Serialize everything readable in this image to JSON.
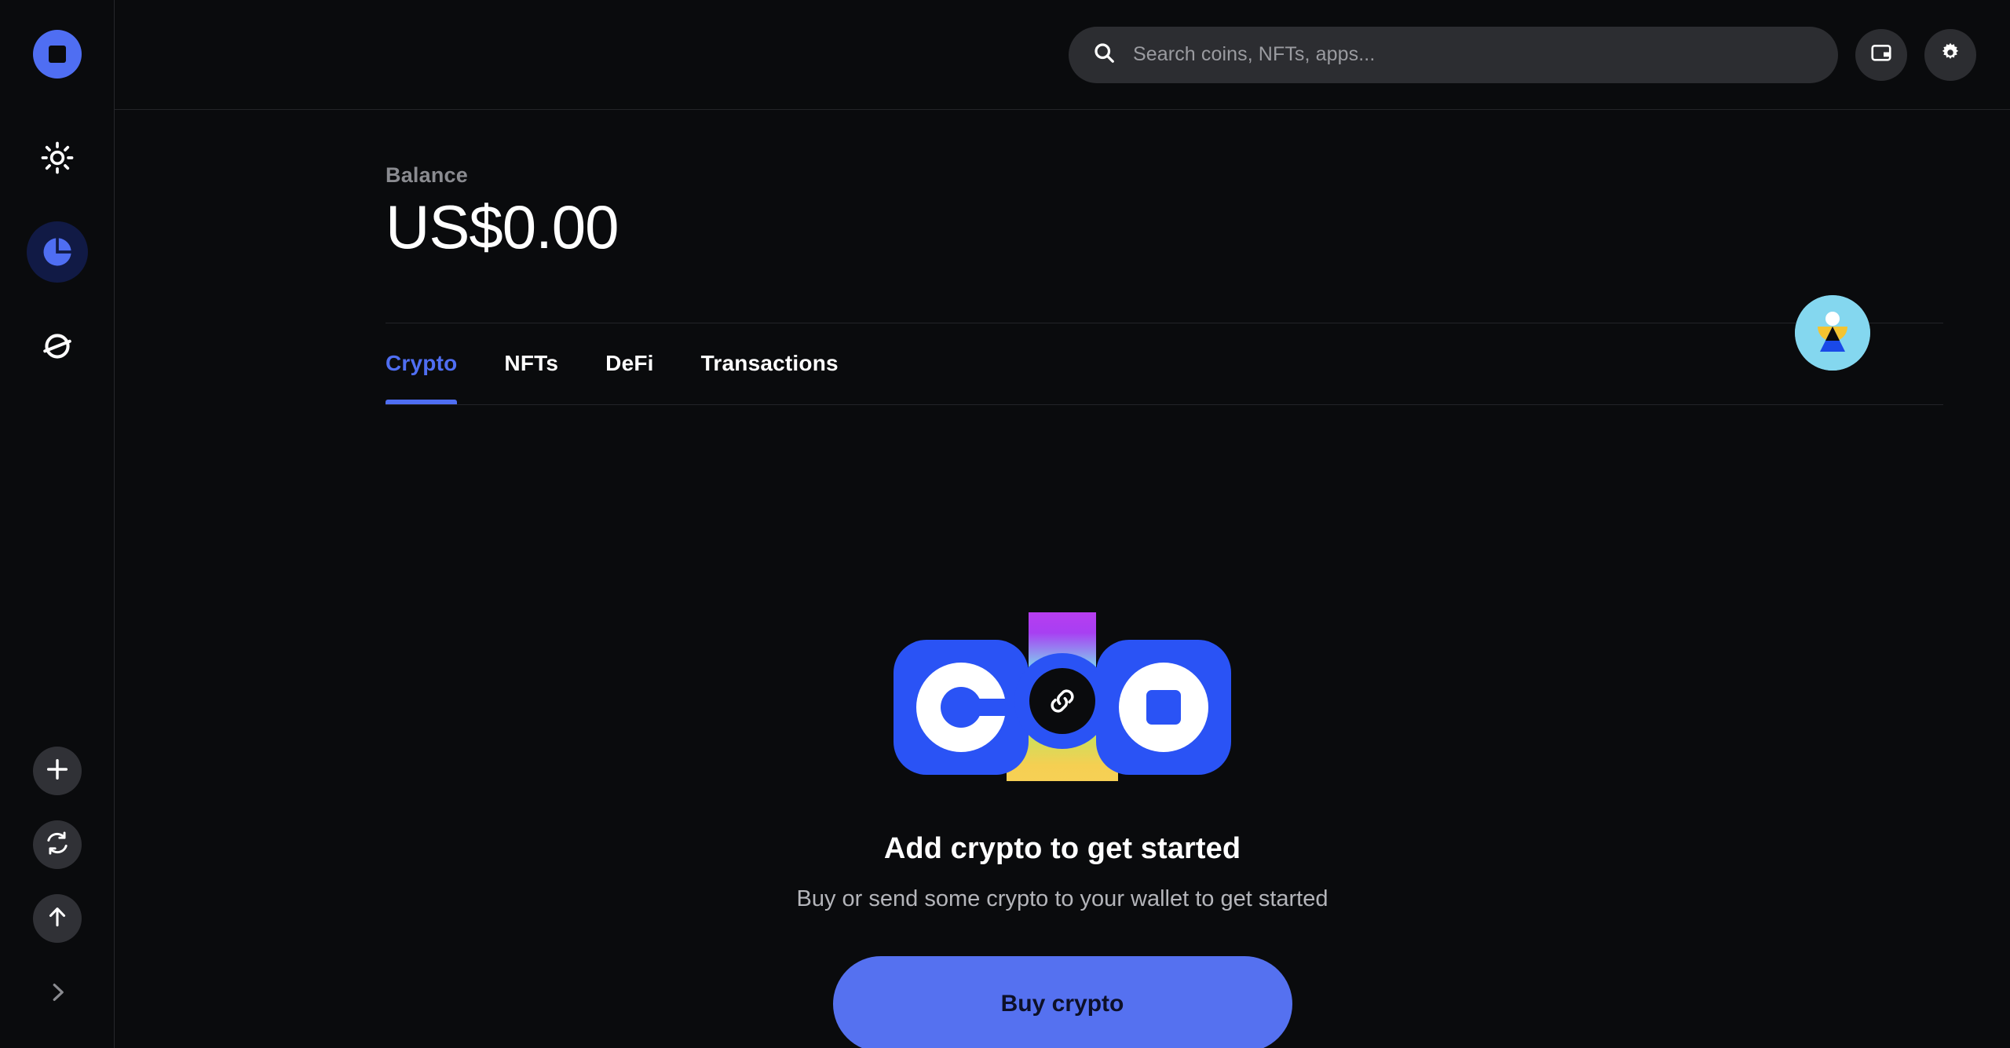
{
  "app": {
    "brand_logo_icon": "coinbase-wallet-logo",
    "background_color": "#0a0b0d",
    "accent_color": "#4f6ef2",
    "button_color": "#5571f0"
  },
  "sidebar": {
    "top_items": [
      {
        "icon": "sun-icon",
        "label": "Brightness",
        "active": false
      },
      {
        "icon": "pie-chart-icon",
        "label": "Assets",
        "active": true
      },
      {
        "icon": "globe-icon",
        "label": "Explore",
        "active": false
      }
    ],
    "bottom_items": [
      {
        "icon": "plus-icon",
        "label": "Buy"
      },
      {
        "icon": "refresh-swap-icon",
        "label": "Swap"
      },
      {
        "icon": "arrow-up-icon",
        "label": "Send"
      }
    ],
    "expand_icon": "chevron-right-icon"
  },
  "header": {
    "search": {
      "icon": "search-icon",
      "placeholder": "Search coins, NFTs, apps...",
      "value": ""
    },
    "actions": [
      {
        "icon": "wallet-icon",
        "label": "Wallet"
      },
      {
        "icon": "gear-icon",
        "label": "Settings"
      }
    ]
  },
  "balance": {
    "label": "Balance",
    "value": "US$0.00"
  },
  "avatar": {
    "name": "profile-avatar",
    "background_color": "#84d7ef",
    "mountain_color": "#1a49e8",
    "crescent_color": "#f4c430",
    "sun_color": "#ffffff"
  },
  "tabs": [
    {
      "label": "Crypto",
      "active": true
    },
    {
      "label": "NFTs",
      "active": false
    },
    {
      "label": "DeFi",
      "active": false
    },
    {
      "label": "Transactions",
      "active": false
    }
  ],
  "empty_state": {
    "illustration": {
      "left_icon": "coinbase-c-logo",
      "center_icon": "link-icon",
      "right_icon": "coinbase-wallet-square-logo"
    },
    "title": "Add crypto to get started",
    "subtitle": "Buy or send some crypto to your wallet to get started",
    "cta_label": "Buy crypto"
  }
}
